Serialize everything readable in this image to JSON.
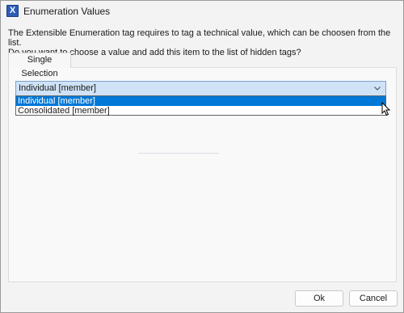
{
  "window": {
    "title": "Enumeration Values",
    "app_icon": "X"
  },
  "message": {
    "line1": "The Extensible Enumeration tag requires to tag a technical value, which can be choosen from the list.",
    "line2": "Do you want to choose a value and add this item to the list of hidden tags?"
  },
  "tabs": [
    {
      "label": "Single Selection",
      "active": true
    }
  ],
  "combo": {
    "value": "Individual [member]",
    "chevron": "⌄",
    "expanded": true,
    "options": [
      {
        "label": "Individual [member]",
        "selected": true
      },
      {
        "label": "Consolidated [member]",
        "selected": false
      }
    ]
  },
  "buttons": {
    "ok": "Ok",
    "cancel": "Cancel"
  },
  "colors": {
    "accent": "#0078d7",
    "combo_bg": "#cfe2f6",
    "combo_border": "#7da2ce",
    "window_bg": "#f3f3f3"
  }
}
